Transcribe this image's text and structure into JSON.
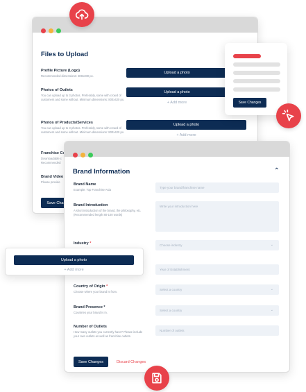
{
  "window_files": {
    "title": "Files to Upload",
    "fields": [
      {
        "label": "Profile Picture (Logo)",
        "desc": "Recommended dimensions: 300x300 px.",
        "button": "Upload a photo",
        "add_more": ""
      },
      {
        "label": "Photos of Outlets",
        "desc": "You can upload up to 3 photos. Preferably, some with crowd of customers and some without. Minimum dimensions: 800x420 px.",
        "button": "Upload a photo",
        "add_more": "+ Add more"
      },
      {
        "label": "Photos of Products/Services",
        "desc": "You can upload up to 3 photos. Preferably, some with crowd of customers and some without. Minimum dimensions: 800x420 px.",
        "button": "Upload a photo",
        "add_more": "+ Add more"
      },
      {
        "label": "Franchise Co",
        "desc": "Downloadable c\nRecommended",
        "button": "",
        "add_more": ""
      },
      {
        "label": "Brand Video",
        "desc": "Please provide",
        "button": "",
        "add_more": ""
      }
    ],
    "save_label": "Save Change"
  },
  "widget": {
    "save_label": "Save Changes"
  },
  "window_brand": {
    "title": "Brand Information",
    "fields": [
      {
        "label": "Brand Name",
        "required": "",
        "desc": "Example: Top Franchise Asia",
        "placeholder": "Type your brand/franchise name"
      },
      {
        "label": "Brand Introduction",
        "required": "",
        "desc": "A short introduction of the brand, the philosophy, etc. (Recommended length 80-100 words)",
        "placeholder": "Write your introduction here"
      },
      {
        "label": "Industry",
        "required": "*",
        "desc": "",
        "placeholder": "Choose industry"
      },
      {
        "label": "",
        "required": "",
        "desc": "",
        "placeholder": "Year of Establishment"
      },
      {
        "label": "Country of Origin",
        "required": "*",
        "desc": "Choose where your brand is from.",
        "placeholder": "Select a country"
      },
      {
        "label": "Brand Presence *",
        "required": "",
        "desc": "Countries your brand is in.",
        "placeholder": "Select a country"
      },
      {
        "label": "Number of Outlets",
        "required": "",
        "desc": "How many outlets you currently have? Please include your own outlets as well as franchise outlets.",
        "placeholder": "Number of outlets"
      }
    ],
    "save_label": "Save Changes",
    "discard_label": "Discard Changes"
  },
  "upload_card": {
    "button": "Upload a photo",
    "add_more": "+ Add more"
  },
  "icons": {
    "top": "cloud-upload-icon",
    "side": "cursor-click-icon",
    "bottom": "save-icon"
  },
  "colors": {
    "navy": "#0d2c54",
    "accent_red": "#e8424a",
    "input_bg": "#eef2f7"
  }
}
